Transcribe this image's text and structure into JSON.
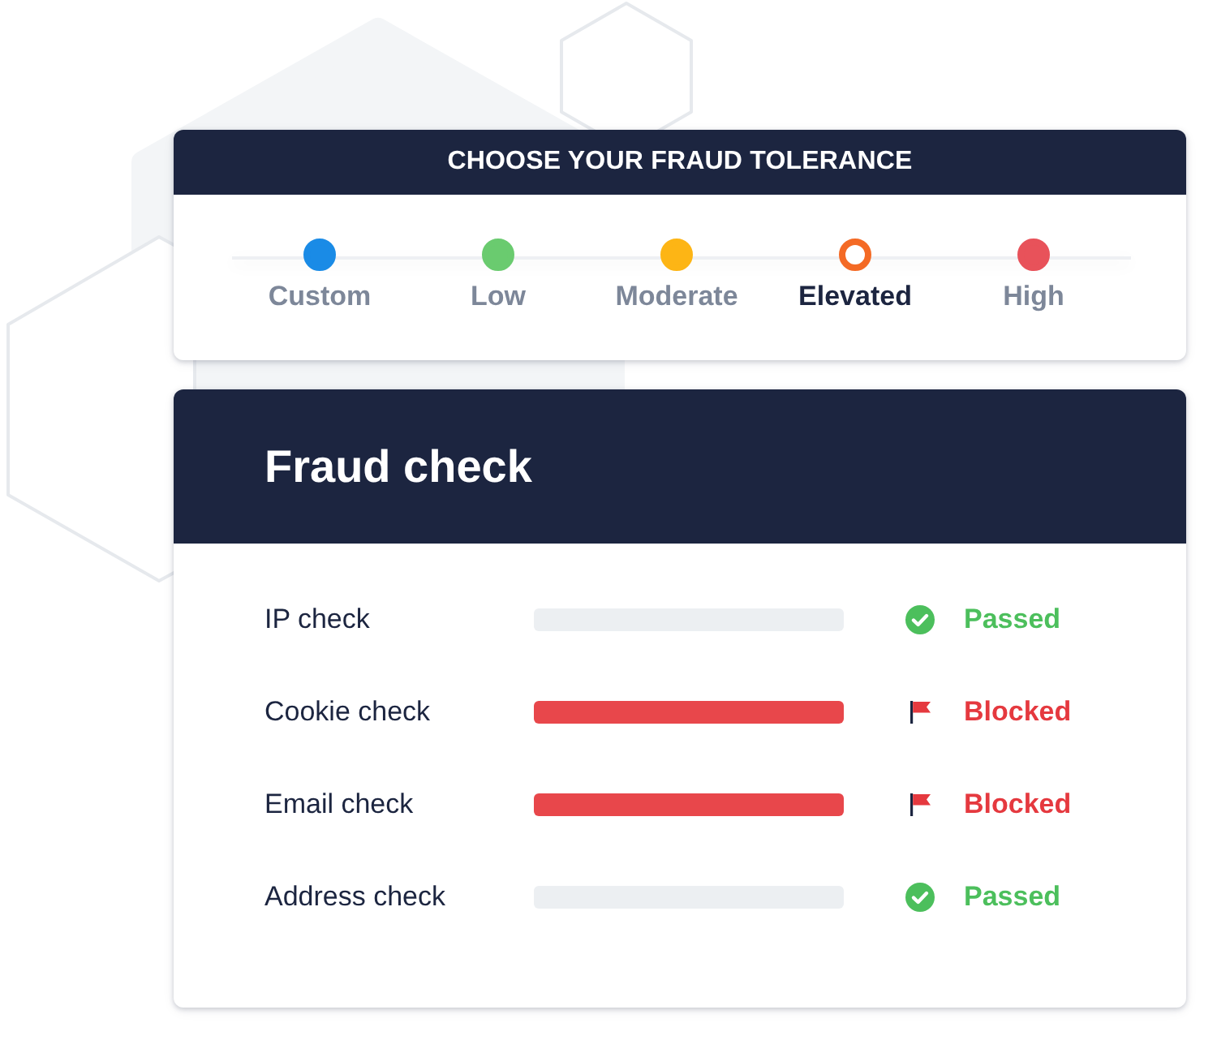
{
  "tolerance": {
    "title": "CHOOSE YOUR FRAUD TOLERANCE",
    "options": [
      {
        "label": "Custom",
        "color": "#1a8be6",
        "selected": false
      },
      {
        "label": "Low",
        "color": "#6acb6f",
        "selected": false
      },
      {
        "label": "Moderate",
        "color": "#fdb515",
        "selected": false
      },
      {
        "label": "Elevated",
        "color": "#f46a25",
        "selected": true
      },
      {
        "label": "High",
        "color": "#e8525a",
        "selected": false
      }
    ]
  },
  "fraud_check": {
    "title": "Fraud check",
    "checks": [
      {
        "label": "IP check",
        "kind": "passed",
        "status": "Passed"
      },
      {
        "label": "Cookie check",
        "kind": "blocked",
        "status": "Blocked"
      },
      {
        "label": "Email check",
        "kind": "blocked",
        "status": "Blocked"
      },
      {
        "label": "Address check",
        "kind": "passed",
        "status": "Passed"
      }
    ]
  }
}
